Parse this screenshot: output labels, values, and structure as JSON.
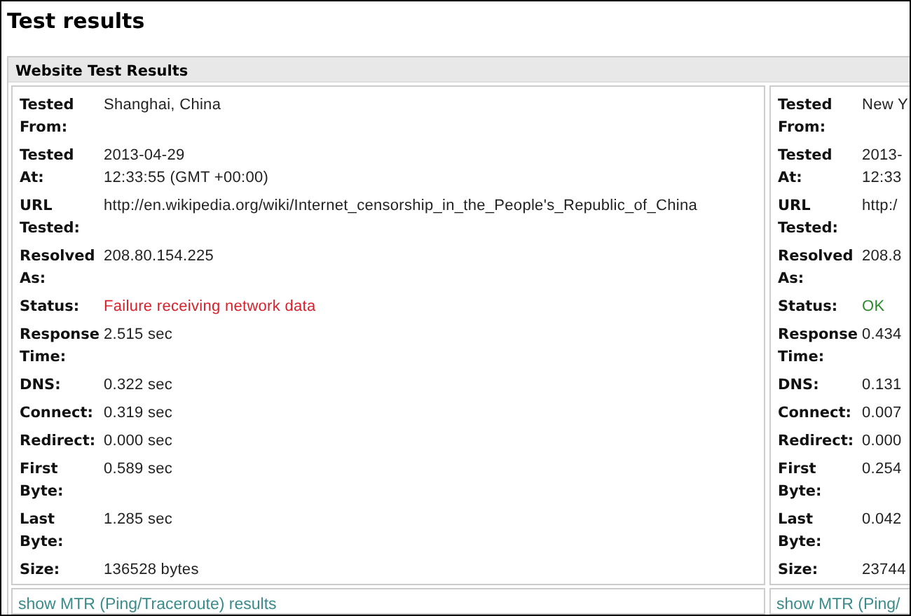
{
  "page_title": "Test results",
  "panel": {
    "title": "Website Test Results",
    "results": [
      {
        "rows": [
          {
            "label": "Tested From:",
            "value": "Shanghai, China"
          },
          {
            "label": "Tested At:",
            "value": "2013-04-29",
            "value_2": "12:33:55 (GMT +00:00)"
          },
          {
            "label": "URL Tested:",
            "value": "http://en.wikipedia.org/wiki/Internet_censorship_in_the_People's_Republic_of_China"
          },
          {
            "label": "Resolved As:",
            "value": "208.80.154.225"
          },
          {
            "label": "Status:",
            "value": "Failure receiving network data",
            "kind": "failure"
          },
          {
            "label": "Response Time:",
            "value": "2.515 sec"
          },
          {
            "label": "DNS:",
            "value": "0.322 sec"
          },
          {
            "label": "Connect:",
            "value": "0.319 sec"
          },
          {
            "label": "Redirect:",
            "value": "0.000 sec"
          },
          {
            "label": "First Byte:",
            "value": "0.589 sec"
          },
          {
            "label": "Last Byte:",
            "value": "1.285 sec"
          },
          {
            "label": "Size:",
            "value": "136528 bytes"
          }
        ],
        "link": "show MTR (Ping/Traceroute) results"
      },
      {
        "rows": [
          {
            "label": "Tested From:",
            "value": "New Y"
          },
          {
            "label": "Tested At:",
            "value": "2013-",
            "value_2": "12:33"
          },
          {
            "label": "URL Tested:",
            "value": "http:/"
          },
          {
            "label": "Resolved As:",
            "value": "208.8"
          },
          {
            "label": "Status:",
            "value": "OK",
            "kind": "ok"
          },
          {
            "label": "Response Time:",
            "value": "0.434"
          },
          {
            "label": "DNS:",
            "value": "0.131"
          },
          {
            "label": "Connect:",
            "value": "0.007"
          },
          {
            "label": "Redirect:",
            "value": "0.000"
          },
          {
            "label": "First Byte:",
            "value": "0.254"
          },
          {
            "label": "Last Byte:",
            "value": "0.042"
          },
          {
            "label": "Size:",
            "value": "23744"
          }
        ],
        "link": "show MTR (Ping/"
      }
    ]
  }
}
